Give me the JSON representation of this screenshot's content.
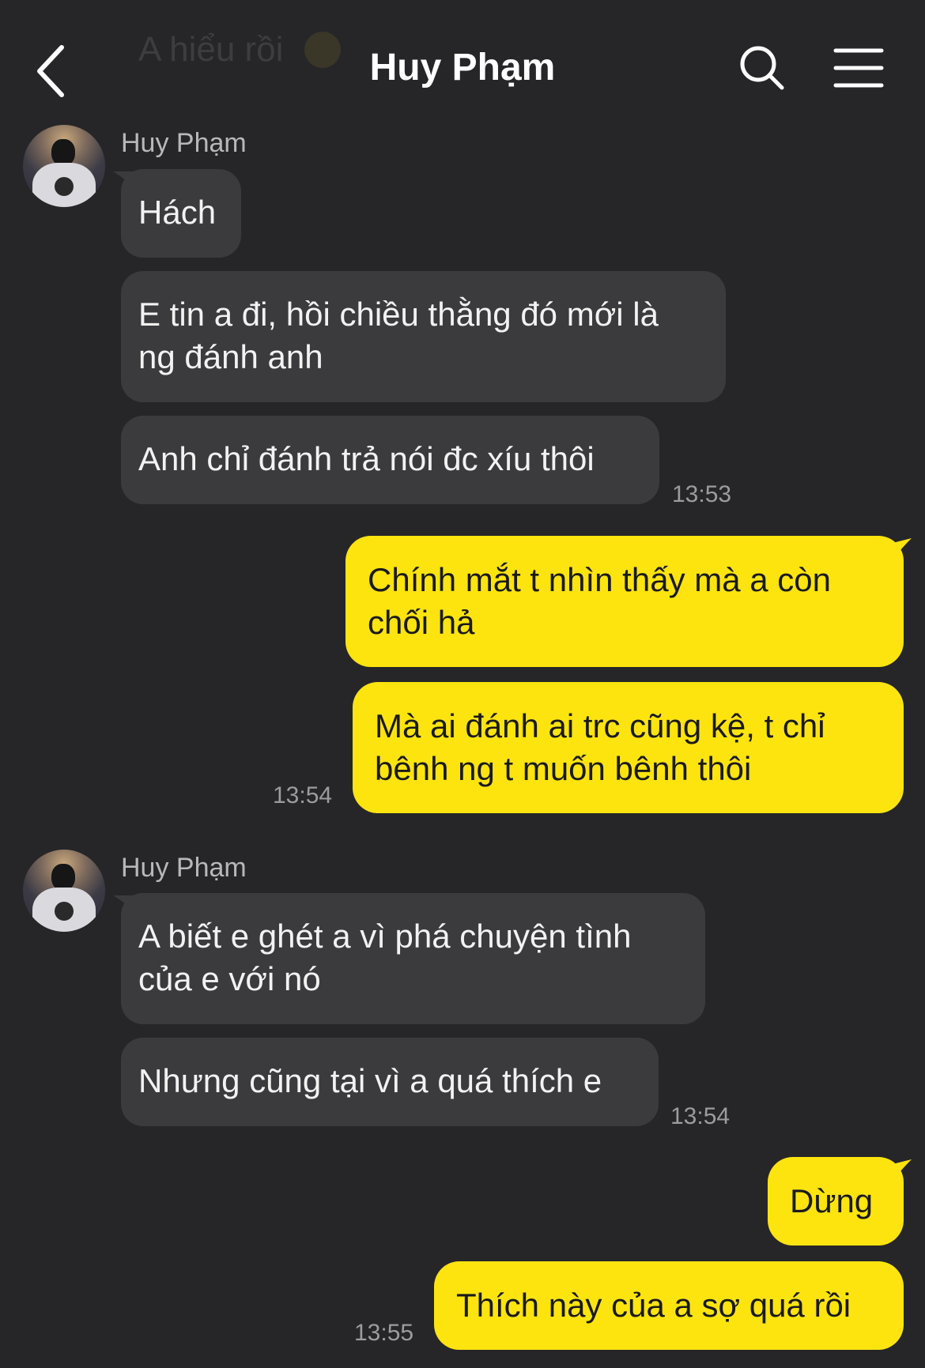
{
  "header": {
    "ghost_text": "A hiểu rồi",
    "title": "Huy Phạm",
    "back_icon": "chevron-left-icon",
    "search_icon": "search-icon",
    "menu_icon": "hamburger-menu-icon"
  },
  "colors": {
    "background": "#262628",
    "incoming_bubble": "#3b3b3e",
    "outgoing_bubble": "#fde40f",
    "timestamp": "#9c9ca0"
  },
  "messages": {
    "group1": {
      "sender": "Huy Phạm",
      "m1": "Hách",
      "m2a": "E tin a đi, hồi chiều thằng đó mới là",
      "m2b": "ng đánh anh",
      "m3": "Anh chỉ đánh trả nói đc xíu thôi",
      "time": "13:53"
    },
    "group2": {
      "m1a": "Chính mắt t nhìn thấy mà a còn",
      "m1b": "chối hả",
      "m2a": "Mà ai đánh ai trc cũng kệ, t chỉ",
      "m2b": "bênh ng t muốn bênh thôi",
      "time": "13:54"
    },
    "group3": {
      "sender": "Huy Phạm",
      "m1a": "A biết e ghét a vì phá chuyện tình",
      "m1b": "của e với nó",
      "m2": "Nhưng cũng tại vì a quá thích e",
      "time": "13:54"
    },
    "group4": {
      "m1": "Dừng",
      "m2": "Thích này của a sợ quá rồi",
      "time": "13:55"
    }
  }
}
